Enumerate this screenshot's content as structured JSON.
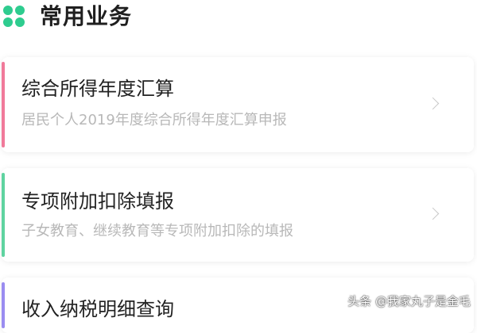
{
  "section": {
    "title": "常用业务",
    "icon": "clover-icon",
    "icon_color": "#2ecc8f"
  },
  "services": [
    {
      "title": "综合所得年度汇算",
      "subtitle": "居民个人2019年度综合所得年度汇算申报",
      "accent_color": "#f07a9a",
      "icon": "chevron-right-icon"
    },
    {
      "title": "专项附加扣除填报",
      "subtitle": "子女教育、继续教育等专项附加扣除的填报",
      "accent_color": "#5fd3a0",
      "icon": "chevron-right-icon"
    },
    {
      "title": "收入纳税明细查询",
      "accent_color": "#9a8cf0"
    }
  ],
  "watermark": "头条 @我家丸子是金毛"
}
